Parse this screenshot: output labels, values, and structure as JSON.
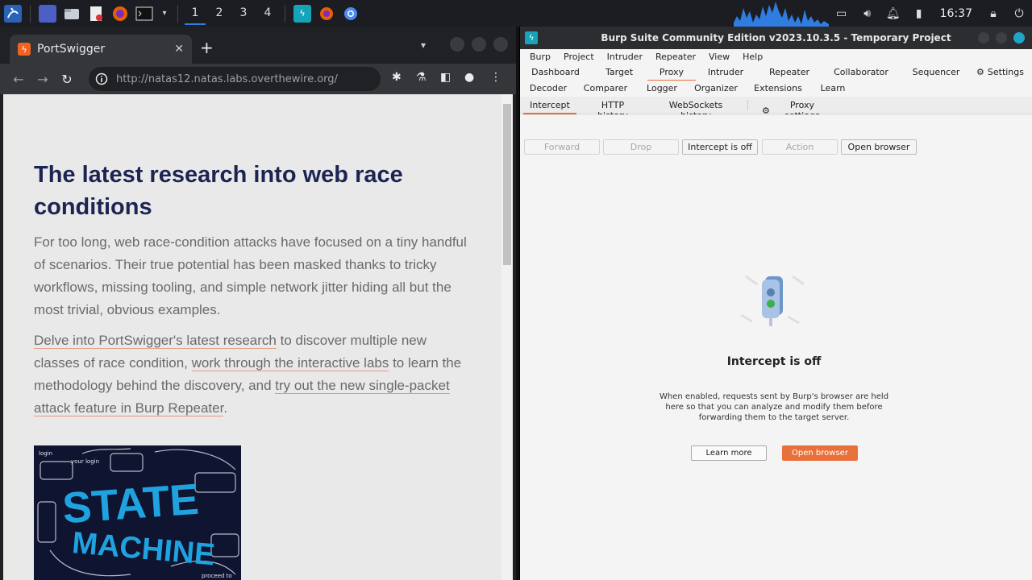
{
  "taskbar": {
    "workspaces": [
      "1",
      "2",
      "3",
      "4"
    ],
    "active_workspace": "1",
    "clock": "16:37"
  },
  "browser": {
    "tab_title": "PortSwigger",
    "url": "http://natas12.natas.labs.overthewire.org/",
    "article": {
      "title": "The latest research into web race conditions",
      "paragraph1": "For too long, web race-condition attacks have focused on a tiny handful of scenarios. Their true potential has been masked thanks to tricky workflows, missing tooling, and simple network jitter hiding all but the most trivial, obvious examples.",
      "p2_link1": "Delve into PortSwigger's latest research",
      "p2_text1": " to discover multiple new classes of race condition, ",
      "p2_link2": "work through the interactive labs",
      "p2_text2": " to learn the methodology behind the discovery, and ",
      "p2_link3": "try out the new single-packet attack feature in Burp Repeater",
      "p2_text3": ".",
      "hero_text_line1": "STATE",
      "hero_text_line2": "MACHINE",
      "hero_scribbles": [
        "login",
        "your login",
        "proceed to"
      ]
    }
  },
  "burp": {
    "title": "Burp Suite Community Edition v2023.10.3.5 - Temporary Project",
    "menu": [
      "Burp",
      "Project",
      "Intruder",
      "Repeater",
      "View",
      "Help"
    ],
    "tabs_row1": [
      "Dashboard",
      "Target",
      "Proxy",
      "Intruder",
      "Repeater",
      "Collaborator",
      "Sequencer",
      "Settings"
    ],
    "tabs_row2": [
      "Decoder",
      "Comparer",
      "Logger",
      "Organizer",
      "Extensions",
      "Learn"
    ],
    "selected_tab": "Proxy",
    "subtabs": [
      "Intercept",
      "HTTP history",
      "WebSockets history",
      "Proxy settings"
    ],
    "selected_subtab": "Intercept",
    "actions": [
      "Forward",
      "Drop",
      "Intercept is off",
      "Action",
      "Open browser"
    ],
    "intercept_title": "Intercept is off",
    "intercept_desc": "When enabled, requests sent by Burp's browser are held here so that you can analyze and modify them before forwarding them to the target server.",
    "learn_more": "Learn more",
    "open_browser": "Open browser",
    "accent": "#e8703a"
  }
}
